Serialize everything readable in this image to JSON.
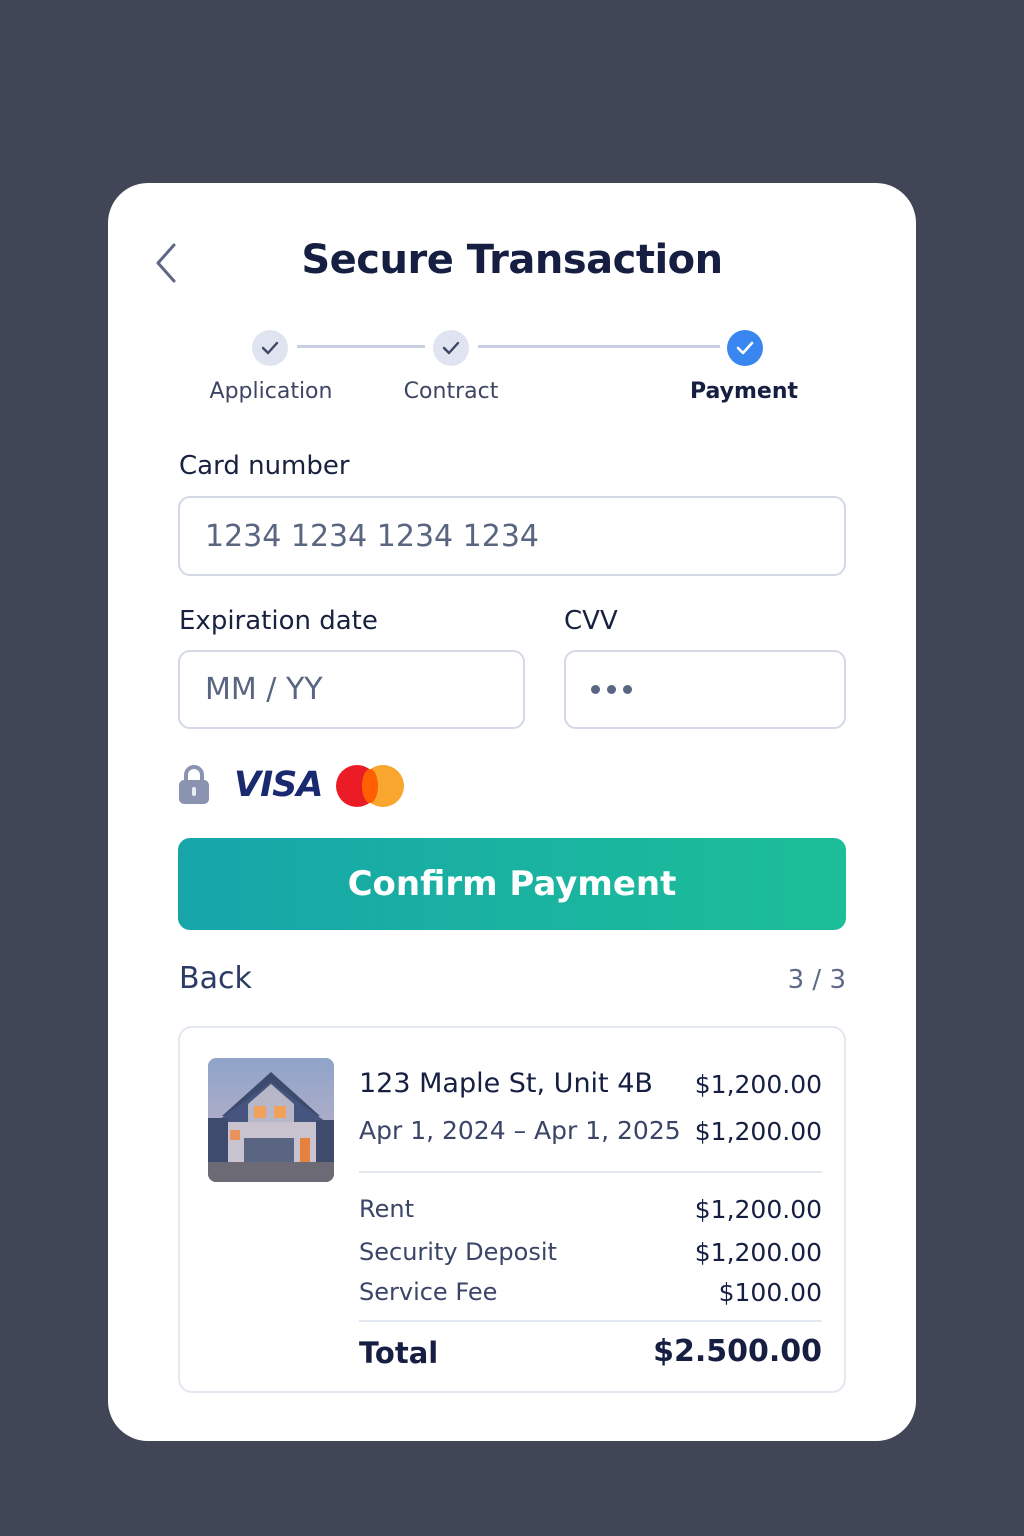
{
  "header": {
    "title": "Secure Transaction"
  },
  "stepper": {
    "steps": [
      {
        "label": "Application",
        "state": "done"
      },
      {
        "label": "Contract",
        "state": "done"
      },
      {
        "label": "Payment",
        "state": "active"
      }
    ]
  },
  "form": {
    "card_number": {
      "label": "Card number",
      "placeholder": "1234 1234 1234 1234"
    },
    "expiration": {
      "label": "Expiration date",
      "placeholder": "MM / YY"
    },
    "cvv": {
      "label": "CVV",
      "placeholder": "•••"
    }
  },
  "badges": {
    "lock_icon": "lock-icon",
    "visa": "VISA",
    "mastercard": "mastercard-logo"
  },
  "actions": {
    "confirm_label": "Confirm Payment",
    "back_label": "Back",
    "page_count": "3 / 3"
  },
  "summary": {
    "address": "123 Maple St, Unit 4B",
    "address_amount": "$1,200.00",
    "dates": "Apr 1, 2024 – Apr 1, 2025",
    "dates_amount": "$1,200.00",
    "lines": [
      {
        "label": "Rent",
        "amount": "$1,200.00"
      },
      {
        "label": "Security Deposit",
        "amount": "$1,200.00"
      },
      {
        "label": "Service Fee",
        "amount": "$100.00"
      }
    ],
    "total_label": "Total",
    "total_amount": "$2.500.00"
  },
  "colors": {
    "background": "#404656",
    "accent_blue": "#3a86f0",
    "button_start": "#17a5aa",
    "button_end": "#1cbf98",
    "text_dark": "#161f42"
  }
}
